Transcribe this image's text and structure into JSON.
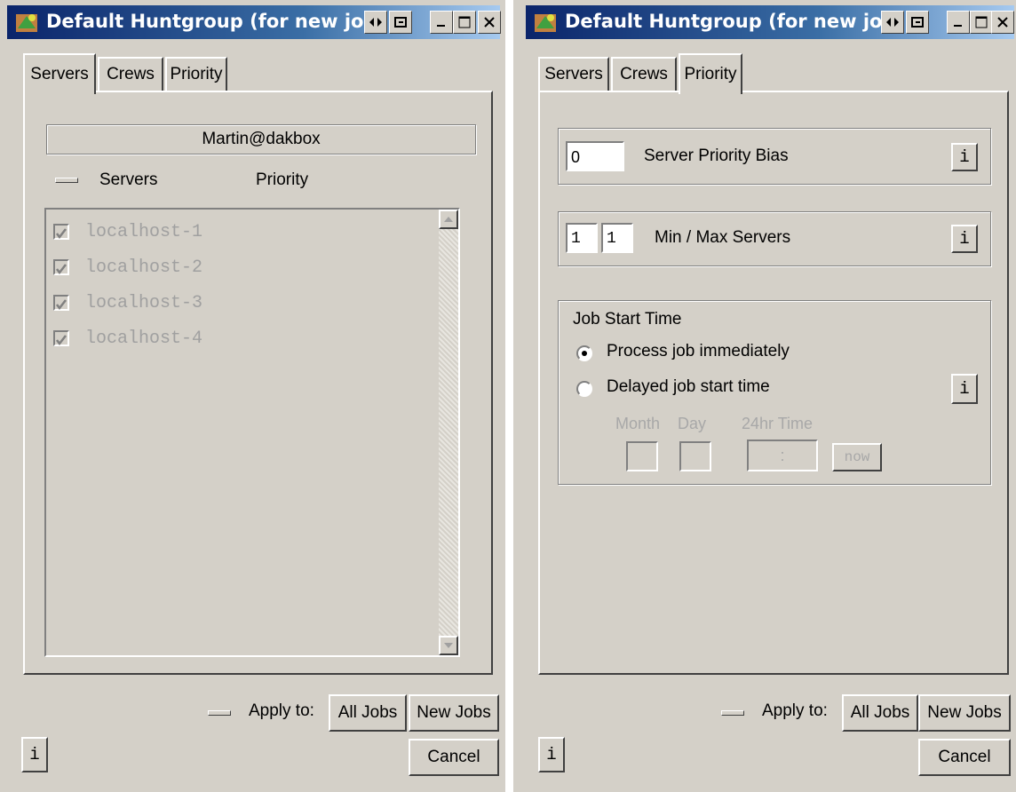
{
  "left": {
    "title": "Default Huntgroup (for new job",
    "tabs": [
      "Servers",
      "Crews",
      "Priority"
    ],
    "crew": "Martin@dakbox",
    "list_headers": {
      "servers": "Servers",
      "priority": "Priority"
    },
    "servers": [
      "localhost-1",
      "localhost-2",
      "localhost-3",
      "localhost-4"
    ],
    "apply_label": "Apply to:",
    "all_jobs": "All Jobs",
    "new_jobs": "New Jobs",
    "cancel": "Cancel",
    "info": "i"
  },
  "right": {
    "title": "Default Huntgroup (for new job",
    "tabs": [
      "Servers",
      "Crews",
      "Priority"
    ],
    "server_priority_bias": {
      "value": "0",
      "label": "Server Priority Bias"
    },
    "min_max": {
      "min": "1",
      "max": "1",
      "label": "Min / Max Servers"
    },
    "job_start": {
      "heading": "Job Start Time",
      "opt_immediate": "Process job immediately",
      "opt_delayed": "Delayed job start time",
      "month": "Month",
      "day": "Day",
      "time": "24hr Time",
      "time_sep": ":",
      "now": "now"
    },
    "apply_label": "Apply to:",
    "all_jobs": "All Jobs",
    "new_jobs": "New Jobs",
    "cancel": "Cancel",
    "info": "i"
  },
  "colors": {
    "face": "#d4d0c8",
    "title_start": "#0a246a",
    "title_end": "#a6caf0",
    "disabled_text": "#a0a0a0"
  },
  "icons": [
    "app-icon",
    "pin-icon",
    "restore-icon",
    "minimize-icon",
    "maximize-icon",
    "close-icon",
    "scroll-up-icon",
    "scroll-down-icon"
  ]
}
